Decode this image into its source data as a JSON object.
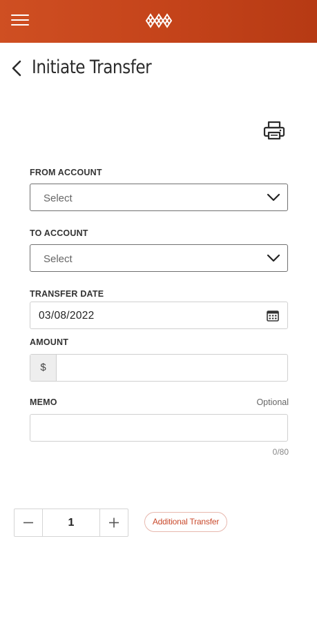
{
  "header": {
    "brand_color": "#c4431a",
    "menu_icon": "hamburger-menu-icon",
    "logo_icon": "brand-logo-icon"
  },
  "page": {
    "title": "Initiate Transfer",
    "back_icon": "chevron-left-icon",
    "print_icon": "printer-icon"
  },
  "form": {
    "from_account": {
      "label": "FROM ACCOUNT",
      "value": "Select"
    },
    "to_account": {
      "label": "TO ACCOUNT",
      "value": "Select"
    },
    "transfer_date": {
      "label": "TRANSFER DATE",
      "value": "03/08/2022",
      "icon": "calendar-icon"
    },
    "amount": {
      "label": "AMOUNT",
      "currency_symbol": "$",
      "value": ""
    },
    "memo": {
      "label": "MEMO",
      "optional_label": "Optional",
      "value": "",
      "counter": "0/80"
    }
  },
  "stepper": {
    "value": "1",
    "minus_icon": "minus-icon",
    "plus_icon": "plus-icon"
  },
  "actions": {
    "additional_transfer_label": "Additional Transfer",
    "accent_color": "#c94a2c"
  }
}
